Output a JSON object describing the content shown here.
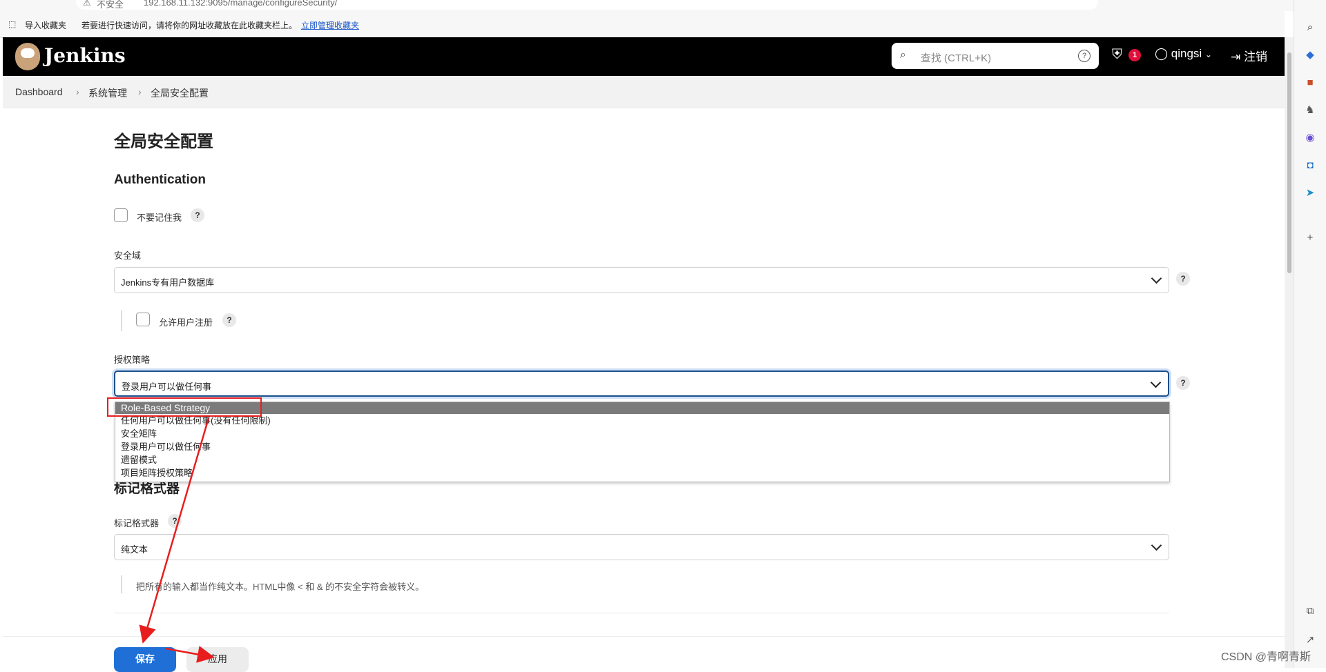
{
  "browser": {
    "security_label": "不安全",
    "url": "192.168.11.132:9095/manage/configureSecurity/",
    "fav_import": "导入收藏夹",
    "fav_hint": "若要进行快速访问，请将你的网址收藏放在此收藏夹栏上。",
    "fav_link": "立即管理收藏夹"
  },
  "header": {
    "brand": "Jenkins",
    "search_placeholder": "查找 (CTRL+K)",
    "notification_count": "1",
    "username": "qingsi",
    "logout": "注销"
  },
  "breadcrumb": [
    "Dashboard",
    "系统管理",
    "全局安全配置"
  ],
  "page": {
    "title": "全局安全配置",
    "auth_heading": "Authentication",
    "remember_me_label": "不要记住我",
    "security_realm_label": "安全域",
    "security_realm_value": "Jenkins专有用户数据库",
    "allow_signup_label": "允许用户注册",
    "authorization_label": "授权策略",
    "authorization_value": "登录用户可以做任何事",
    "authorization_options": [
      "Role-Based Strategy",
      "任何用户可以做任何事(没有任何限制)",
      "安全矩阵",
      "登录用户可以做任何事",
      "遗留模式",
      "项目矩阵授权策略"
    ],
    "markup_heading": "标记格式器",
    "markup_label": "标记格式器",
    "markup_value": "纯文本",
    "markup_description": "把所有的输入都当作纯文本。HTML中像 < 和 & 的不安全字符会被转义。"
  },
  "buttons": {
    "save": "保存",
    "apply": "应用"
  },
  "help_glyph": "?",
  "watermark": "CSDN @青啊青斯",
  "colors": {
    "header_bg": "#000000",
    "primary_button": "#1f6fd6",
    "annotation_red": "#e81e1e",
    "selected_option_bg": "#7b7b7b"
  }
}
